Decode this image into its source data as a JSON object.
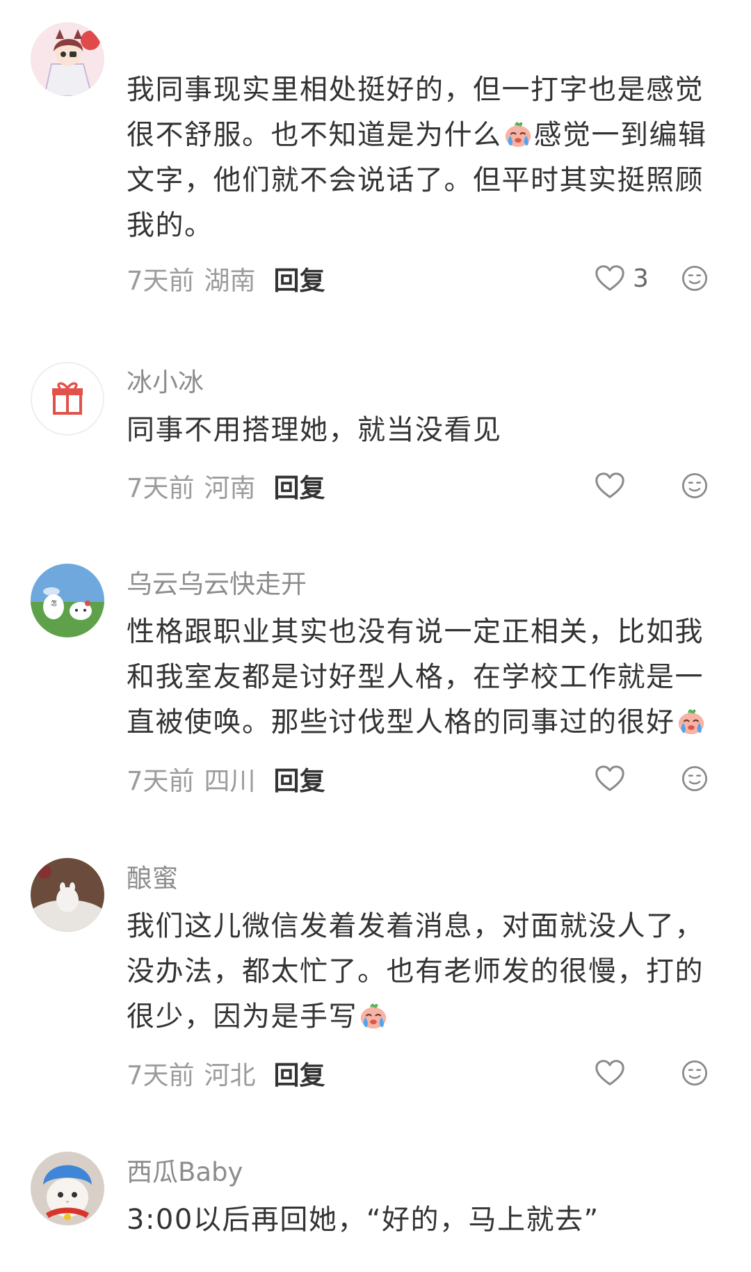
{
  "comments": [
    {
      "username": "",
      "segments": [
        "我同事现实里相处挺好的，但一打字也是感觉很不舒服。也不知道是为什么",
        "感觉一到编辑文字，他们就不会说话了。但平时其实挺照顾我的。"
      ],
      "inline_emoji": "crying-face-emoji",
      "time": "7天前",
      "region": "湖南",
      "reply_label": "回复",
      "like_count": "3"
    },
    {
      "username": "冰小冰",
      "segments": [
        "同事不用搭理她，就当没看见"
      ],
      "time": "7天前",
      "region": "河南",
      "reply_label": "回复",
      "like_count": ""
    },
    {
      "username": "乌云乌云快走开",
      "segments": [
        "性格跟职业其实也没有说一定正相关，比如我和我室友都是讨好型人格，在学校工作就是一直被使唤。那些讨伐型人格的同事过的很好"
      ],
      "inline_emoji": "crying-face-emoji",
      "time": "7天前",
      "region": "四川",
      "reply_label": "回复",
      "like_count": ""
    },
    {
      "username": "酿蜜",
      "segments": [
        "我们这儿微信发着发着消息，对面就没人了，没办法，都太忙了。也有老师发的很慢，打的很少，因为是手写"
      ],
      "inline_emoji": "crying-face-emoji",
      "time": "7天前",
      "region": "河北",
      "reply_label": "回复",
      "like_count": ""
    },
    {
      "username": "西瓜Baby",
      "segments": [
        "3:00以后再回她，“好的，马上就去”"
      ]
    }
  ],
  "colors": {
    "username": "#8c8c8c",
    "content": "#333333",
    "meta": "#9b9b9b",
    "icon": "#8a8a8a"
  },
  "icons": [
    "heart-outline-icon",
    "smiley-icon",
    "gift-icon",
    "crying-face-emoji"
  ]
}
